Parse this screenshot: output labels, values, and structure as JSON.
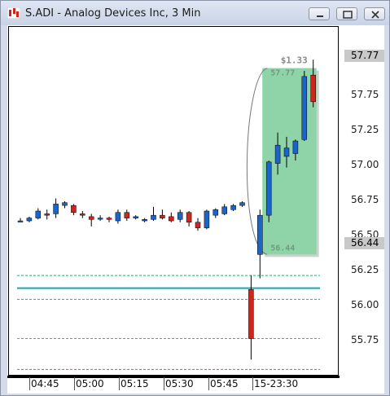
{
  "window": {
    "title": "S.ADI - Analog Devices Inc, 3 Min",
    "controls": [
      "minimize",
      "restore",
      "close"
    ]
  },
  "price_axis": {
    "labels": [
      "57.75",
      "57.50",
      "57.25",
      "57.00",
      "56.75",
      "56.50",
      "56.25",
      "56.00",
      "55.75"
    ],
    "last_price_tag": "57.77",
    "low_price_tag": "56.44"
  },
  "time_axis": {
    "labels": [
      "04:45",
      "05:00",
      "05:15",
      "05:30",
      "05:45",
      "15-23:30"
    ]
  },
  "annotation": {
    "change": "$1.33",
    "high": "57.77",
    "low": "56.44"
  },
  "colors": {
    "up_candle": "#1b64c8",
    "down_candle": "#c8281e",
    "highlight_box": "#8fd4a8",
    "band_line": "#1fb36b",
    "mid_line": "#1aa6b0",
    "grey_line": "#8c8c8c",
    "pink_line": "#cc44aa"
  },
  "chart_data": {
    "type": "candlestick",
    "y_unit": "USD",
    "ylim": [
      55.6,
      58.0
    ],
    "candles": [
      {
        "o": 56.68,
        "h": 56.7,
        "l": 56.67,
        "c": 56.68
      },
      {
        "o": 56.68,
        "h": 56.71,
        "l": 56.67,
        "c": 56.7
      },
      {
        "o": 56.7,
        "h": 56.77,
        "l": 56.69,
        "c": 56.75
      },
      {
        "o": 56.73,
        "h": 56.76,
        "l": 56.69,
        "c": 56.72
      },
      {
        "o": 56.73,
        "h": 56.84,
        "l": 56.7,
        "c": 56.8
      },
      {
        "o": 56.79,
        "h": 56.82,
        "l": 56.77,
        "c": 56.81
      },
      {
        "o": 56.79,
        "h": 56.8,
        "l": 56.72,
        "c": 56.74
      },
      {
        "o": 56.73,
        "h": 56.75,
        "l": 56.7,
        "c": 56.72
      },
      {
        "o": 56.71,
        "h": 56.73,
        "l": 56.64,
        "c": 56.69
      },
      {
        "o": 56.7,
        "h": 56.72,
        "l": 56.68,
        "c": 56.7
      },
      {
        "o": 56.7,
        "h": 56.71,
        "l": 56.67,
        "c": 56.69
      },
      {
        "o": 56.68,
        "h": 56.76,
        "l": 56.66,
        "c": 56.74
      },
      {
        "o": 56.74,
        "h": 56.76,
        "l": 56.68,
        "c": 56.7
      },
      {
        "o": 56.7,
        "h": 56.72,
        "l": 56.69,
        "c": 56.71
      },
      {
        "o": 56.68,
        "h": 56.7,
        "l": 56.67,
        "c": 56.69
      },
      {
        "o": 56.69,
        "h": 56.78,
        "l": 56.68,
        "c": 56.72
      },
      {
        "o": 56.72,
        "h": 56.76,
        "l": 56.69,
        "c": 56.7
      },
      {
        "o": 56.71,
        "h": 56.74,
        "l": 56.67,
        "c": 56.68
      },
      {
        "o": 56.69,
        "h": 56.76,
        "l": 56.67,
        "c": 56.74
      },
      {
        "o": 56.74,
        "h": 56.75,
        "l": 56.64,
        "c": 56.67
      },
      {
        "o": 56.67,
        "h": 56.7,
        "l": 56.61,
        "c": 56.63
      },
      {
        "o": 56.63,
        "h": 56.76,
        "l": 56.62,
        "c": 56.75
      },
      {
        "o": 56.72,
        "h": 56.77,
        "l": 56.7,
        "c": 56.76
      },
      {
        "o": 56.73,
        "h": 56.8,
        "l": 56.72,
        "c": 56.78
      },
      {
        "o": 56.76,
        "h": 56.8,
        "l": 56.75,
        "c": 56.79
      },
      {
        "o": 56.79,
        "h": 56.82,
        "l": 56.78,
        "c": 56.81
      },
      {
        "o": 56.19,
        "h": 56.29,
        "l": 55.69,
        "c": 55.84
      },
      {
        "o": 56.44,
        "h": 56.76,
        "l": 56.27,
        "c": 56.72
      },
      {
        "o": 56.72,
        "h": 57.11,
        "l": 56.67,
        "c": 57.1
      },
      {
        "o": 57.09,
        "h": 57.31,
        "l": 57.01,
        "c": 57.22
      },
      {
        "o": 57.14,
        "h": 57.28,
        "l": 57.06,
        "c": 57.2
      },
      {
        "o": 57.16,
        "h": 57.26,
        "l": 57.11,
        "c": 57.25
      },
      {
        "o": 57.26,
        "h": 57.75,
        "l": 57.25,
        "c": 57.71
      },
      {
        "o": 57.72,
        "h": 57.83,
        "l": 57.49,
        "c": 57.53
      }
    ],
    "horizontal_lines": [
      {
        "name": "band-upper",
        "value": 56.29
      },
      {
        "name": "midline",
        "value": 56.2
      },
      {
        "name": "band-lower",
        "value": 56.12
      },
      {
        "name": "grey-level",
        "value": 55.84
      },
      {
        "name": "pink-level",
        "value": 55.62
      }
    ],
    "range_box": {
      "from_index": 28,
      "to_index": 33,
      "high": 57.77,
      "low": 56.44
    }
  }
}
